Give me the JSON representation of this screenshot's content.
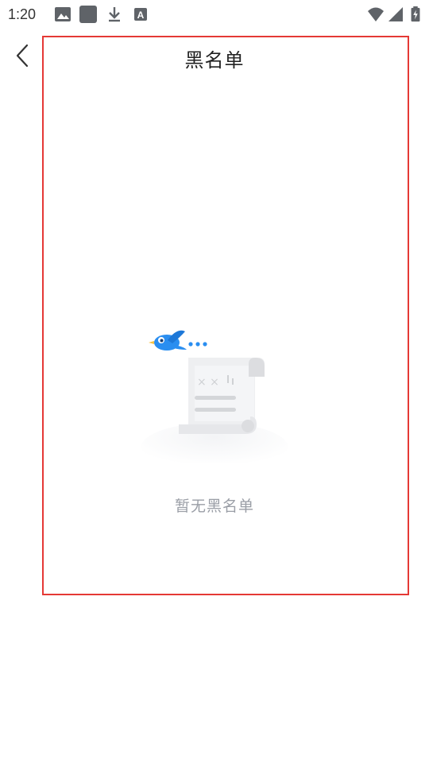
{
  "status_bar": {
    "time": "1:20",
    "icons": [
      "image-icon",
      "square-app-icon",
      "download-icon",
      "a-text-icon",
      "wifi-icon",
      "signal-icon",
      "battery-charging-icon"
    ]
  },
  "header": {
    "title": "黑名单",
    "back_icon": "chevron-left-icon"
  },
  "empty_state": {
    "message": "暂无黑名单",
    "illustration": "bird-and-paper-scroll-illustration"
  },
  "colors": {
    "highlight_border": "#e53935",
    "empty_text": "#9a9ea6",
    "bird_blue": "#2a8ef0"
  }
}
